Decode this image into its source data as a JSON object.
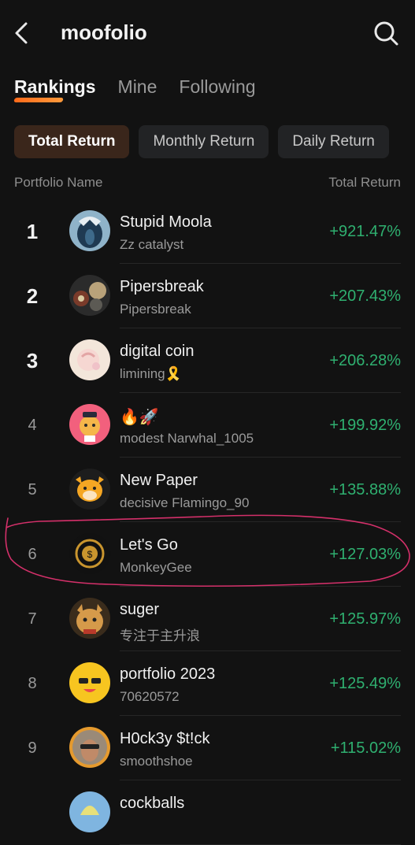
{
  "header": {
    "title": "moofolio",
    "back_icon": "back-arrow-icon",
    "search_icon": "search-icon"
  },
  "tabs": [
    {
      "label": "Rankings",
      "active": true
    },
    {
      "label": "Mine",
      "active": false
    },
    {
      "label": "Following",
      "active": false
    }
  ],
  "filters": [
    {
      "label": "Total Return",
      "active": true
    },
    {
      "label": "Monthly Return",
      "active": false
    },
    {
      "label": "Daily Return",
      "active": false
    }
  ],
  "columns": {
    "name": "Portfolio Name",
    "return": "Total Return"
  },
  "colors": {
    "positive": "#2fb070",
    "accent": "#ff6a1a",
    "highlight_ink": "#d4306a"
  },
  "rankings": [
    {
      "rank": "1",
      "name": "Stupid Moola",
      "owner": "Zz catalyst",
      "return": "+921.47%"
    },
    {
      "rank": "2",
      "name": "Pipersbreak",
      "owner": "Pipersbreak",
      "return": "+207.43%"
    },
    {
      "rank": "3",
      "name": "digital coin",
      "owner": "limining🎗️",
      "return": "+206.28%"
    },
    {
      "rank": "4",
      "name": "🔥🚀",
      "owner": "modest Narwhal_1005",
      "return": "+199.92%"
    },
    {
      "rank": "5",
      "name": "New Paper",
      "owner": "decisive Flamingo_90",
      "return": "+135.88%"
    },
    {
      "rank": "6",
      "name": "Let's Go",
      "owner": "MonkeyGee",
      "return": "+127.03%"
    },
    {
      "rank": "7",
      "name": "suger",
      "owner": "专注于主升浪",
      "return": "+125.97%"
    },
    {
      "rank": "8",
      "name": "portfolio 2023",
      "owner": "70620572",
      "return": "+125.49%"
    },
    {
      "rank": "9",
      "name": "H0ck3y $t!ck",
      "owner": "smoothshoe",
      "return": "+115.02%"
    },
    {
      "rank": "",
      "name": "cockballs",
      "owner": "",
      "return": ""
    }
  ]
}
